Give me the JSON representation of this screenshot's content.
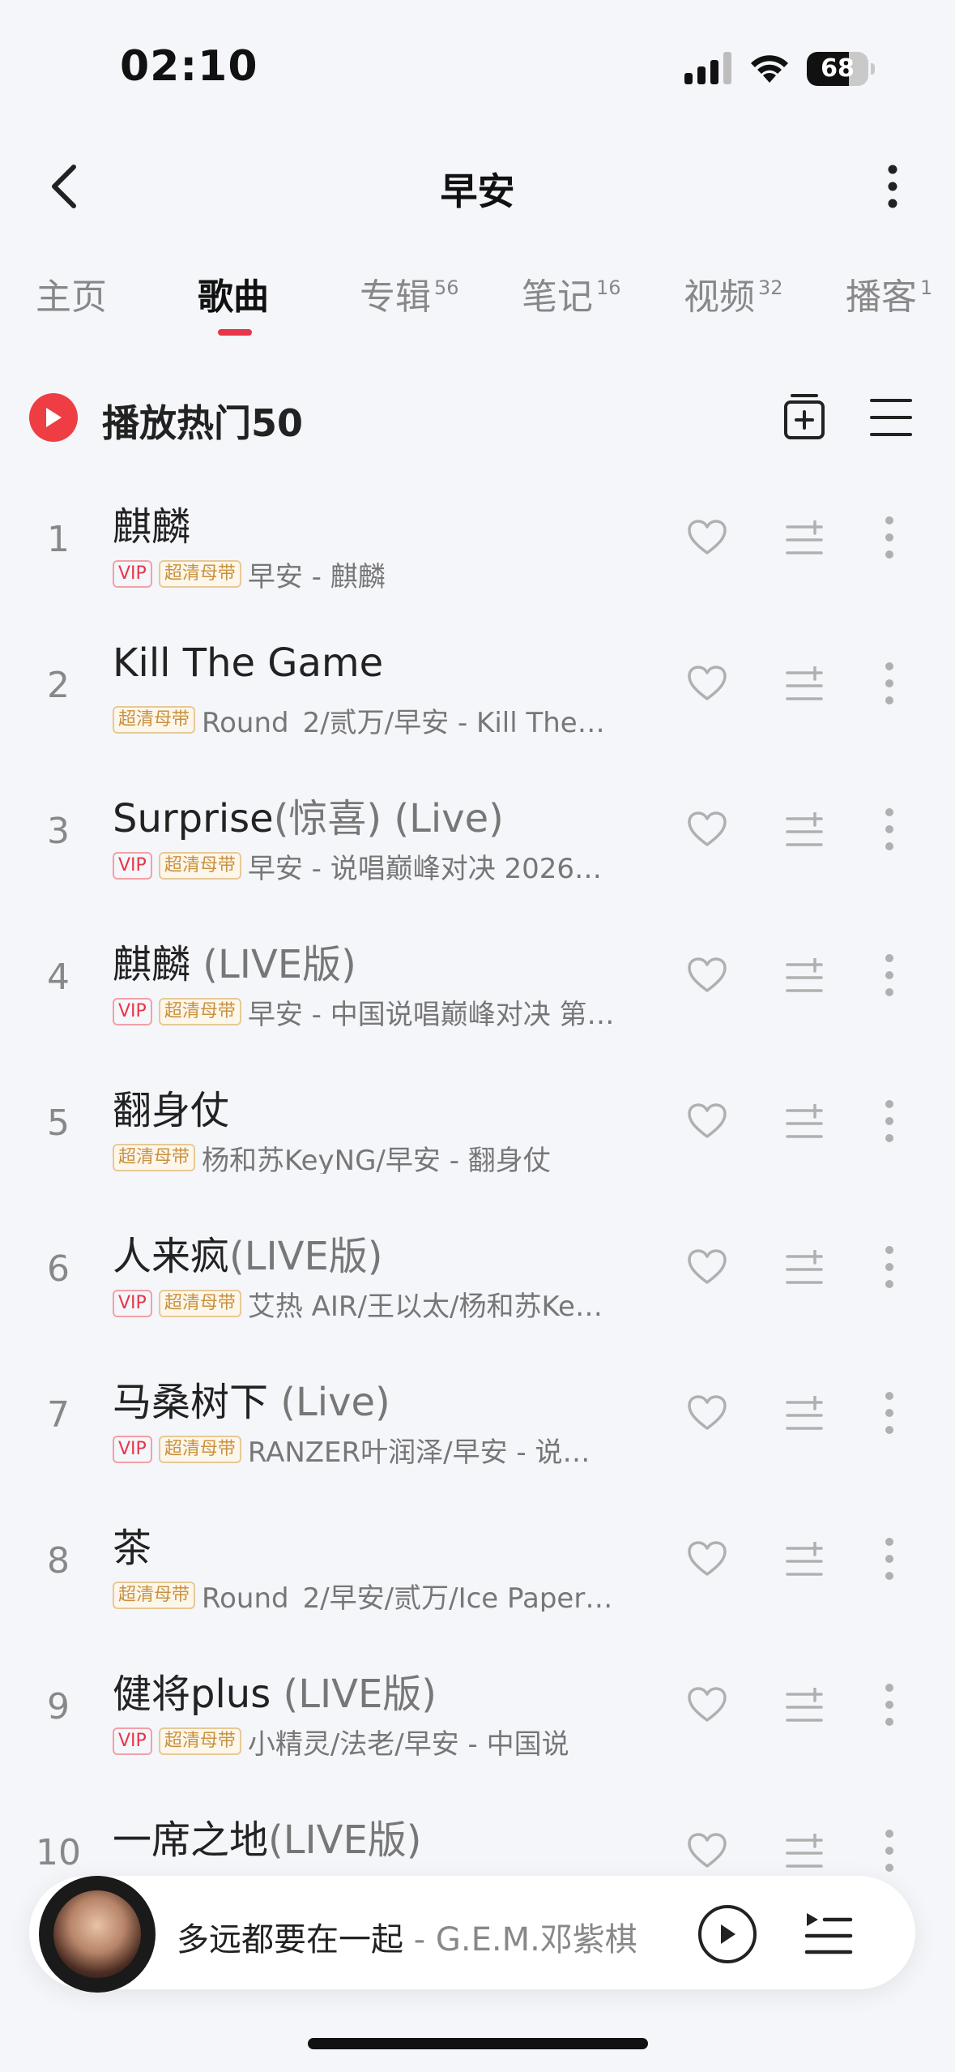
{
  "status_bar": {
    "time": "02:10",
    "battery": "68",
    "battery_level": 0.68
  },
  "header": {
    "title": "早安"
  },
  "tabs": [
    {
      "label": "主页",
      "count": ""
    },
    {
      "label": "歌曲",
      "count": ""
    },
    {
      "label": "专辑",
      "count": "56"
    },
    {
      "label": "笔记",
      "count": "16"
    },
    {
      "label": "视频",
      "count": "32"
    },
    {
      "label": "播客",
      "count": "1"
    }
  ],
  "active_tab": "歌曲",
  "play_all": {
    "label": "播放热门50"
  },
  "tags": {
    "vip": "VIP",
    "hq": "超清母带"
  },
  "songs": [
    {
      "index": "1",
      "title": "麒麟",
      "title_suffix": "",
      "vip": true,
      "hq": true,
      "subtitle": "早安 - 麒麟"
    },
    {
      "index": "2",
      "title": "Kill The Game",
      "title_suffix": "",
      "vip": false,
      "hq": true,
      "subtitle": "Round_2/贰万/早安 - Kill The…"
    },
    {
      "index": "3",
      "title": "Surprise",
      "title_suffix": "(惊喜) (Live)",
      "vip": true,
      "hq": true,
      "subtitle": "早安 - 说唱巅峰对决 2026…"
    },
    {
      "index": "4",
      "title": "麒麟",
      "title_suffix": " (LIVE版)",
      "vip": true,
      "hq": true,
      "subtitle": "早安 - 中国说唱巅峰对决 第…"
    },
    {
      "index": "5",
      "title": "翻身仗",
      "title_suffix": "",
      "vip": false,
      "hq": true,
      "subtitle": "杨和苏KeyNG/早安 - 翻身仗"
    },
    {
      "index": "6",
      "title": "人来疯",
      "title_suffix": "(LIVE版)",
      "vip": true,
      "hq": true,
      "subtitle": "艾热 AIR/王以太/杨和苏Ke…"
    },
    {
      "index": "7",
      "title": "马桑树下",
      "title_suffix": " (Live)",
      "vip": true,
      "hq": true,
      "subtitle": "RANZER叶润泽/早安 - 说…"
    },
    {
      "index": "8",
      "title": "茶",
      "title_suffix": "",
      "vip": false,
      "hq": true,
      "subtitle": "Round_2/早安/贰万/Ice Paper…"
    },
    {
      "index": "9",
      "title": "健将plus",
      "title_suffix": " (LIVE版)",
      "vip": true,
      "hq": true,
      "subtitle": "小精灵/法老/早安 - 中国说"
    },
    {
      "index": "10",
      "title": "一席之地",
      "title_suffix": "(LIVE版)",
      "vip": false,
      "hq": false,
      "subtitle": ""
    }
  ],
  "player": {
    "song": "多远都要在一起",
    "artist": " - G.E.M.邓紫棋"
  },
  "colors": {
    "accent": "#e8354a",
    "play_red": "#ee3e44",
    "hq_gold": "#c9913e"
  },
  "icons": [
    "back-arrow-icon",
    "more-vertical-icon",
    "play-circle-icon",
    "add-collection-icon",
    "list-menu-icon",
    "heart-icon",
    "add-to-queue-icon",
    "play-icon",
    "playlist-icon"
  ]
}
